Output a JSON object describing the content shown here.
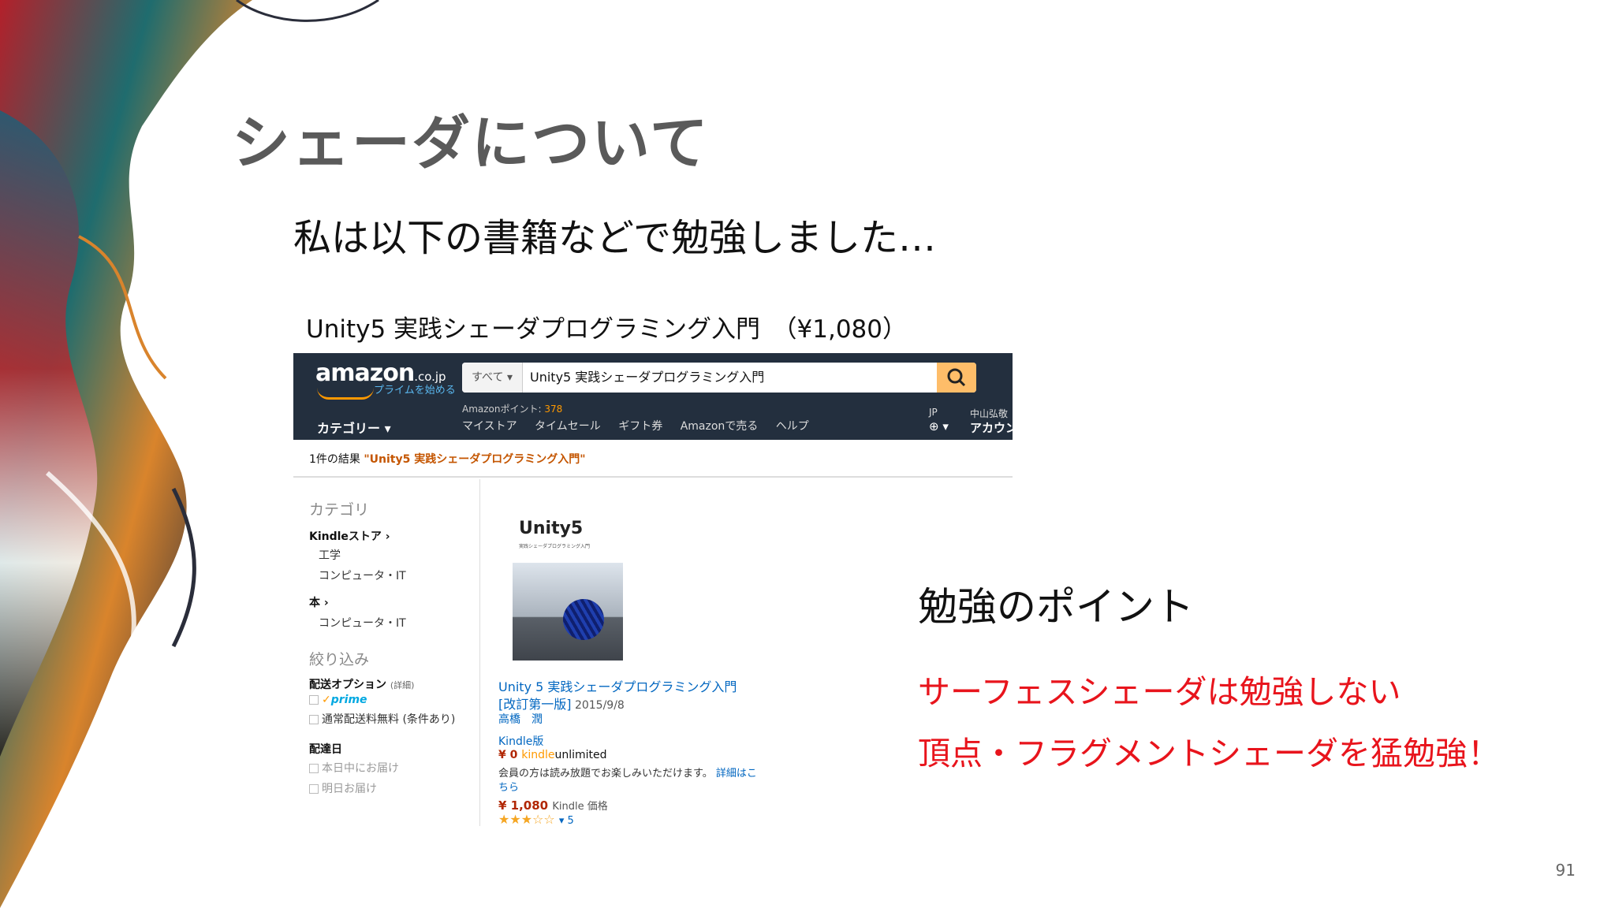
{
  "slide": {
    "title": "シェーダについて",
    "subtitle": "私は以下の書籍などで勉強しました…",
    "book_caption": "Unity5 実践シェーダプログラミング入門　（¥1,080）",
    "study_heading": "勉強のポイント",
    "points": [
      "サーフェスシェーダは勉強しない",
      "頂点・フラグメントシェーダを猛勉強！"
    ],
    "page_number": "91",
    "accent_color": "#e8141c"
  },
  "amazon": {
    "logo": "amazon",
    "logo_domain": ".co.jp",
    "prime_link": "プライムを始める",
    "search_category": "すべて ▾",
    "search_value": "Unity5 実践シェーダプログラミング入門",
    "search_icon": "search-icon",
    "points_label": "Amazonポイント: ",
    "points_value": "378",
    "category_menu": "カテゴリー ▾",
    "nav_links": [
      "マイストア",
      "タイムセール",
      "ギフト券",
      "Amazonで売る",
      "ヘルプ"
    ],
    "region": "JP",
    "globe": "⊕ ▾",
    "account_name": "中山弘敬",
    "account": "アカウント",
    "results_prefix": "1件の結果 ",
    "results_query": "\"Unity5 実践シェーダプログラミング入門\"",
    "sidebar": {
      "category_head": "カテゴリ",
      "kindle_store": "Kindleストア ›",
      "kindle_sub": [
        "工学",
        "コンピュータ・IT"
      ],
      "books": "本 ›",
      "books_sub": "コンピュータ・IT",
      "refine_head": "絞り込み",
      "shipping_option": "配送オプション",
      "shipping_detail": "(詳細)",
      "prime": "prime",
      "free_shipping": "通常配送料無料 (条件あり)",
      "delivery_date": "配達日",
      "today": "本日中にお届け",
      "tomorrow": "明日お届け"
    },
    "product": {
      "cover_title": "Unity5",
      "cover_subtitle": "実践シェーダプログラミング入門",
      "title_line1": "Unity 5 実践シェーダプログラミング入門",
      "title_line2": "[改訂第一版]",
      "date": " 2015/9/8",
      "author": "高橋　潤",
      "format": "Kindle版",
      "price_zero": "¥ 0 ",
      "ku_1": "kindle",
      "ku_2": "unlimited",
      "member_text": "会員の方は読み放題でお楽しみいただけます。",
      "details_link": "詳細はこ",
      "details_link2": "ちら",
      "price": "¥ 1,080 ",
      "price_label": "Kindle 価格",
      "rating": "★★★☆☆",
      "rating_count": "▾ 5"
    }
  }
}
